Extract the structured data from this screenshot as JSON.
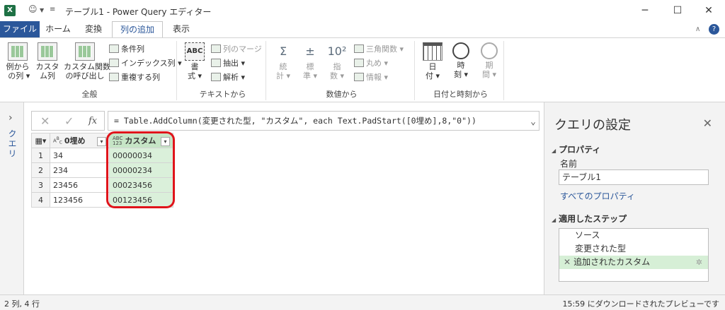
{
  "titlebar": {
    "app_logo": "X",
    "smiley": "☺",
    "title": "テーブル1 - Power Query エディター",
    "minimize": "─",
    "maximize": "☐",
    "close": "✕"
  },
  "tabs": [
    {
      "label": "ファイル"
    },
    {
      "label": "ホーム"
    },
    {
      "label": "変換"
    },
    {
      "label": "列の追加"
    },
    {
      "label": "表示"
    }
  ],
  "ribbon": {
    "general": {
      "label": "全般",
      "example_col": "例から\n の列 ▾",
      "custom_col": "カスタ\nム列",
      "invoke_custom_fn": "カスタム関数\nの呼び出し",
      "conditional_col": "条件列",
      "index_col": "インデックス列 ▾",
      "duplicate_col": "重複する列"
    },
    "text": {
      "label": "テキストから",
      "format": "書\n式 ▾",
      "merge_cols": "列のマージ",
      "extract": "抽出 ▾",
      "parse": "解析 ▾"
    },
    "number": {
      "label": "数値から",
      "statistics": "統\n計 ▾",
      "standard": "標\n準 ▾",
      "scientific": "指\n数 ▾",
      "trig": "三角関数 ▾",
      "rounding": "丸め ▾",
      "information": "情報 ▾"
    },
    "datetime": {
      "label": "日付と時刻から",
      "date": "日\n付 ▾",
      "time": "時\n刻 ▾",
      "duration": "期\n間 ▾"
    }
  },
  "querypane": {
    "label": "クエリ"
  },
  "formula": {
    "cancel": "✕",
    "commit": "✓",
    "fx": "fx",
    "text": "= Table.AddColumn(変更された型, \"カスタム\", each Text.PadStart([0埋め],8,\"0\"))"
  },
  "grid": {
    "columns": [
      {
        "type": "ABC",
        "type_sub": "C",
        "name": "0埋め"
      },
      {
        "type": "ABC",
        "type_sub": "123",
        "name": "カスタム"
      }
    ],
    "rows": [
      {
        "index": "1",
        "c1": "34",
        "c2": "00000034"
      },
      {
        "index": "2",
        "c1": "234",
        "c2": "00000234"
      },
      {
        "index": "3",
        "c1": "23456",
        "c2": "00023456"
      },
      {
        "index": "4",
        "c1": "123456",
        "c2": "00123456"
      }
    ]
  },
  "settings": {
    "title": "クエリの設定",
    "properties_header": "プロパティ",
    "name_label": "名前",
    "name_value": "テーブル1",
    "all_properties": "すべてのプロパティ",
    "steps_header": "適用したステップ",
    "steps": [
      {
        "label": "ソース"
      },
      {
        "label": "変更された型"
      },
      {
        "label": "追加されたカスタム"
      }
    ]
  },
  "status": {
    "left": "2 列, 4 行",
    "right": "15:59 にダウンロードされたプレビューです"
  },
  "colors": {
    "accent": "#2b579a",
    "highlight": "#e0141b",
    "selected_col": "#daf0da"
  }
}
